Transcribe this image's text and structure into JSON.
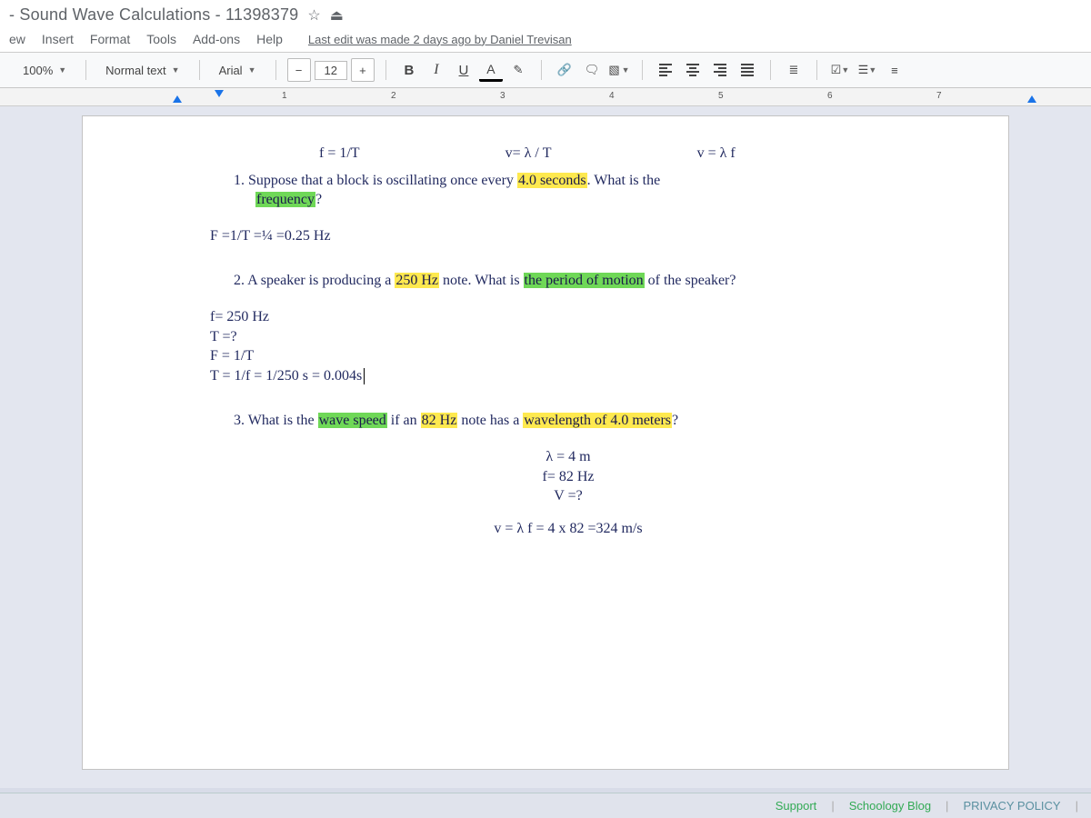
{
  "header": {
    "doc_title": "- Sound Wave Calculations - 11398379",
    "last_edit": "Last edit was made 2 days ago by Daniel Trevisan"
  },
  "menu": {
    "items": [
      "ew",
      "Insert",
      "Format",
      "Tools",
      "Add-ons",
      "Help"
    ]
  },
  "toolbar": {
    "zoom": "100%",
    "style": "Normal text",
    "font": "Arial",
    "size": "12",
    "bold": "B",
    "italic": "I",
    "underline": "U",
    "textcolor": "A"
  },
  "ruler": {
    "marks": [
      "1",
      "2",
      "3",
      "4",
      "5",
      "6",
      "7"
    ]
  },
  "doc": {
    "formula1": "f = 1/T",
    "formula2": "v= λ / T",
    "formula3": "v = λ f",
    "q1_num": "1.",
    "q1_a": "Suppose that a block is oscillating once every ",
    "q1_hl1": "4.0 seconds",
    "q1_b": ". What is the ",
    "q1_hl2": "frequency",
    "q1_c": "?",
    "ans1": "F =1/T =¼ =0.25 Hz",
    "q2_num": "2.",
    "q2_a": "A speaker is producing a ",
    "q2_hl1": "250 Hz",
    "q2_b": " note. What is ",
    "q2_hl2": "the period of motion",
    "q2_c": " of the speaker?",
    "a2_l1": "f= 250 Hz",
    "a2_l2": "T =?",
    "a2_l3": "F = 1/T",
    "a2_l4": "T = 1/f  = 1/250 s = 0.004s",
    "q3_num": "3.",
    "q3_a": "What is the ",
    "q3_hl1": "wave speed",
    "q3_b": " if an ",
    "q3_hl2": "82 Hz",
    "q3_c": " note has a ",
    "q3_hl3": "wavelength of 4.0 meters",
    "q3_d": "?",
    "a3_l1": "λ = 4 m",
    "a3_l2": "f= 82 Hz",
    "a3_l3": "V =?",
    "a3_l4": "v = λ f = 4 x 82 =324 m/s"
  },
  "footer": {
    "support": "Support",
    "blog": "Schoology Blog",
    "privacy": "PRIVACY POLICY"
  }
}
